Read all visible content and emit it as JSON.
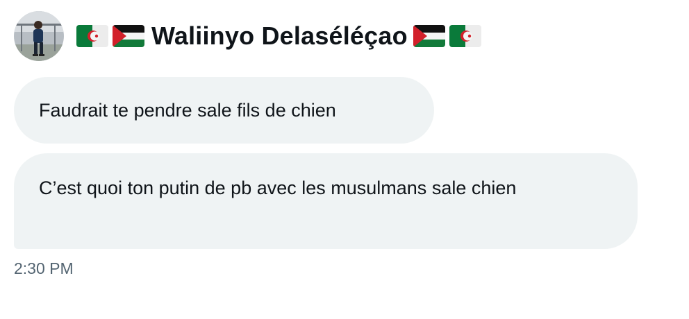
{
  "sender": {
    "display_name": "Waliinyo Delaséléçao",
    "avatar": "avatar-photo",
    "flags_before": [
      "algeria-flag",
      "palestine-flag"
    ],
    "flags_after": [
      "palestine-flag",
      "algeria-flag"
    ]
  },
  "messages": [
    {
      "text": "Faudrait te pendre sale fils de chien"
    },
    {
      "text": "C’est quoi ton putin de pb avec les musulmans sale chien"
    }
  ],
  "timestamp": "2:30 PM",
  "colors": {
    "bubble_bg": "#eff3f4",
    "text": "#0f1419",
    "timestamp": "#536471"
  }
}
